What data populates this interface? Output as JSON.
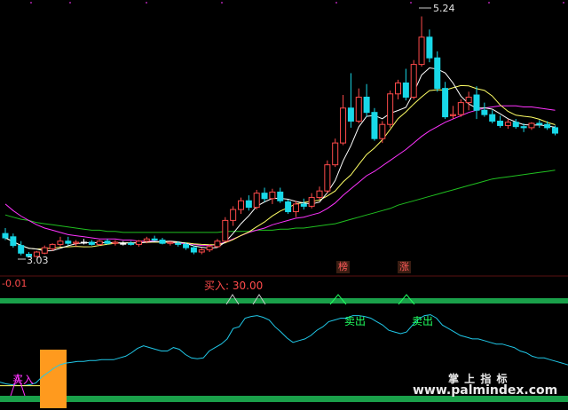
{
  "chart_data": [
    {
      "type": "candlestick",
      "price_labels": {
        "high": "5.24",
        "low": "3.03"
      },
      "markers": [
        "榜",
        "涨"
      ],
      "colors": {
        "up": "#ff4b4b",
        "down": "#18d8e8",
        "flat": "#ffffff",
        "ma_short": "#ffffff",
        "ma_mid": "#ffff66",
        "ma_long": "#ff33ff",
        "ma_longest": "#20c020"
      },
      "candles": [
        {
          "o": 3.25,
          "h": 3.3,
          "l": 3.19,
          "c": 3.21
        },
        {
          "o": 3.22,
          "h": 3.25,
          "l": 3.12,
          "c": 3.14
        },
        {
          "o": 3.14,
          "h": 3.18,
          "l": 3.05,
          "c": 3.07
        },
        {
          "o": 3.06,
          "h": 3.08,
          "l": 3.03,
          "c": 3.04
        },
        {
          "o": 3.04,
          "h": 3.09,
          "l": 3.03,
          "c": 3.08
        },
        {
          "o": 3.07,
          "h": 3.14,
          "l": 3.06,
          "c": 3.12
        },
        {
          "o": 3.11,
          "h": 3.16,
          "l": 3.09,
          "c": 3.15
        },
        {
          "o": 3.15,
          "h": 3.22,
          "l": 3.13,
          "c": 3.18
        },
        {
          "o": 3.18,
          "h": 3.22,
          "l": 3.14,
          "c": 3.16
        },
        {
          "o": 3.16,
          "h": 3.19,
          "l": 3.13,
          "c": 3.17
        },
        {
          "o": 3.17,
          "h": 3.2,
          "l": 3.15,
          "c": 3.17
        },
        {
          "o": 3.17,
          "h": 3.19,
          "l": 3.14,
          "c": 3.15
        },
        {
          "o": 3.15,
          "h": 3.19,
          "l": 3.14,
          "c": 3.18
        },
        {
          "o": 3.18,
          "h": 3.2,
          "l": 3.15,
          "c": 3.16
        },
        {
          "o": 3.16,
          "h": 3.19,
          "l": 3.14,
          "c": 3.17
        },
        {
          "o": 3.16,
          "h": 3.18,
          "l": 3.14,
          "c": 3.16
        },
        {
          "o": 3.16,
          "h": 3.18,
          "l": 3.14,
          "c": 3.15
        },
        {
          "o": 3.15,
          "h": 3.19,
          "l": 3.13,
          "c": 3.18
        },
        {
          "o": 3.18,
          "h": 3.22,
          "l": 3.16,
          "c": 3.2
        },
        {
          "o": 3.2,
          "h": 3.23,
          "l": 3.18,
          "c": 3.19
        },
        {
          "o": 3.19,
          "h": 3.21,
          "l": 3.15,
          "c": 3.16
        },
        {
          "o": 3.16,
          "h": 3.18,
          "l": 3.14,
          "c": 3.17
        },
        {
          "o": 3.16,
          "h": 3.18,
          "l": 3.13,
          "c": 3.15
        },
        {
          "o": 3.15,
          "h": 3.17,
          "l": 3.1,
          "c": 3.12
        },
        {
          "o": 3.12,
          "h": 3.14,
          "l": 3.06,
          "c": 3.08
        },
        {
          "o": 3.08,
          "h": 3.12,
          "l": 3.06,
          "c": 3.1
        },
        {
          "o": 3.1,
          "h": 3.15,
          "l": 3.08,
          "c": 3.13
        },
        {
          "o": 3.13,
          "h": 3.2,
          "l": 3.12,
          "c": 3.18
        },
        {
          "o": 3.18,
          "h": 3.4,
          "l": 3.17,
          "c": 3.37
        },
        {
          "o": 3.37,
          "h": 3.5,
          "l": 3.32,
          "c": 3.47
        },
        {
          "o": 3.47,
          "h": 3.58,
          "l": 3.43,
          "c": 3.55
        },
        {
          "o": 3.55,
          "h": 3.6,
          "l": 3.46,
          "c": 3.49
        },
        {
          "o": 3.49,
          "h": 3.65,
          "l": 3.47,
          "c": 3.62
        },
        {
          "o": 3.62,
          "h": 3.67,
          "l": 3.54,
          "c": 3.57
        },
        {
          "o": 3.57,
          "h": 3.66,
          "l": 3.52,
          "c": 3.63
        },
        {
          "o": 3.63,
          "h": 3.67,
          "l": 3.53,
          "c": 3.55
        },
        {
          "o": 3.54,
          "h": 3.56,
          "l": 3.43,
          "c": 3.45
        },
        {
          "o": 3.45,
          "h": 3.55,
          "l": 3.4,
          "c": 3.52
        },
        {
          "o": 3.52,
          "h": 3.57,
          "l": 3.47,
          "c": 3.5
        },
        {
          "o": 3.5,
          "h": 3.62,
          "l": 3.48,
          "c": 3.58
        },
        {
          "o": 3.58,
          "h": 3.68,
          "l": 3.56,
          "c": 3.64
        },
        {
          "o": 3.64,
          "h": 3.92,
          "l": 3.62,
          "c": 3.88
        },
        {
          "o": 3.88,
          "h": 4.12,
          "l": 3.86,
          "c": 4.08
        },
        {
          "o": 4.08,
          "h": 4.52,
          "l": 4.06,
          "c": 4.4
        },
        {
          "o": 4.4,
          "h": 4.72,
          "l": 4.22,
          "c": 4.28
        },
        {
          "o": 4.28,
          "h": 4.58,
          "l": 4.26,
          "c": 4.5
        },
        {
          "o": 4.5,
          "h": 4.62,
          "l": 4.32,
          "c": 4.36
        },
        {
          "o": 4.36,
          "h": 4.4,
          "l": 4.1,
          "c": 4.12
        },
        {
          "o": 4.12,
          "h": 4.28,
          "l": 4.08,
          "c": 4.25
        },
        {
          "o": 4.25,
          "h": 4.56,
          "l": 4.22,
          "c": 4.53
        },
        {
          "o": 4.53,
          "h": 4.66,
          "l": 4.48,
          "c": 4.63
        },
        {
          "o": 4.63,
          "h": 4.76,
          "l": 4.47,
          "c": 4.5
        },
        {
          "o": 4.5,
          "h": 4.84,
          "l": 4.48,
          "c": 4.8
        },
        {
          "o": 4.8,
          "h": 5.24,
          "l": 4.78,
          "c": 5.05
        },
        {
          "o": 5.05,
          "h": 5.12,
          "l": 4.82,
          "c": 4.86
        },
        {
          "o": 4.86,
          "h": 4.92,
          "l": 4.55,
          "c": 4.58
        },
        {
          "o": 4.58,
          "h": 4.64,
          "l": 4.3,
          "c": 4.32
        },
        {
          "o": 4.33,
          "h": 4.42,
          "l": 4.3,
          "c": 4.34
        },
        {
          "o": 4.34,
          "h": 4.48,
          "l": 4.32,
          "c": 4.45
        },
        {
          "o": 4.45,
          "h": 4.55,
          "l": 4.38,
          "c": 4.5
        },
        {
          "o": 4.52,
          "h": 4.6,
          "l": 4.3,
          "c": 4.38
        },
        {
          "o": 4.38,
          "h": 4.45,
          "l": 4.32,
          "c": 4.34
        },
        {
          "o": 4.34,
          "h": 4.38,
          "l": 4.26,
          "c": 4.28
        },
        {
          "o": 4.28,
          "h": 4.33,
          "l": 4.22,
          "c": 4.24
        },
        {
          "o": 4.24,
          "h": 4.3,
          "l": 4.21,
          "c": 4.27
        },
        {
          "o": 4.27,
          "h": 4.3,
          "l": 4.21,
          "c": 4.23
        },
        {
          "o": 4.23,
          "h": 4.26,
          "l": 4.18,
          "c": 4.22
        },
        {
          "o": 4.22,
          "h": 4.27,
          "l": 4.2,
          "c": 4.26
        },
        {
          "o": 4.26,
          "h": 4.29,
          "l": 4.22,
          "c": 4.25
        },
        {
          "o": 4.25,
          "h": 4.28,
          "l": 4.2,
          "c": 4.22
        },
        {
          "o": 4.22,
          "h": 4.24,
          "l": 4.15,
          "c": 4.17
        }
      ],
      "ma_long": [
        3.52,
        3.46,
        3.41,
        3.37,
        3.33,
        3.3,
        3.28,
        3.26,
        3.24,
        3.23,
        3.22,
        3.21,
        3.2,
        3.2,
        3.2,
        3.19,
        3.19,
        3.18,
        3.18,
        3.18,
        3.17,
        3.17,
        3.16,
        3.16,
        3.15,
        3.14,
        3.14,
        3.15,
        3.17,
        3.2,
        3.23,
        3.26,
        3.28,
        3.3,
        3.33,
        3.35,
        3.37,
        3.39,
        3.4,
        3.42,
        3.44,
        3.48,
        3.53,
        3.6,
        3.66,
        3.72,
        3.78,
        3.82,
        3.87,
        3.92,
        3.97,
        4.02,
        4.08,
        4.14,
        4.19,
        4.23,
        4.27,
        4.3,
        4.33,
        4.36,
        4.38,
        4.4,
        4.41,
        4.42,
        4.42,
        4.42,
        4.41,
        4.41,
        4.4,
        4.39,
        4.38
      ],
      "ma_longest": [
        3.42,
        3.4,
        3.38,
        3.37,
        3.35,
        3.34,
        3.33,
        3.32,
        3.31,
        3.3,
        3.29,
        3.28,
        3.28,
        3.27,
        3.27,
        3.26,
        3.26,
        3.26,
        3.26,
        3.26,
        3.26,
        3.26,
        3.26,
        3.26,
        3.26,
        3.26,
        3.26,
        3.26,
        3.27,
        3.27,
        3.27,
        3.27,
        3.28,
        3.28,
        3.28,
        3.29,
        3.29,
        3.3,
        3.3,
        3.31,
        3.32,
        3.33,
        3.34,
        3.36,
        3.38,
        3.4,
        3.42,
        3.44,
        3.46,
        3.48,
        3.51,
        3.53,
        3.55,
        3.57,
        3.59,
        3.61,
        3.63,
        3.65,
        3.67,
        3.69,
        3.71,
        3.73,
        3.75,
        3.76,
        3.77,
        3.78,
        3.79,
        3.8,
        3.81,
        3.82,
        3.83
      ],
      "ylim": [
        2.95,
        5.35
      ]
    },
    {
      "type": "line",
      "readout": "-0.01",
      "title": "买入: 30.00",
      "signals": {
        "buy": "买入",
        "sell": "卖出"
      },
      "values": [
        22,
        20,
        19,
        18,
        18,
        19,
        21,
        28,
        33,
        38,
        42,
        44,
        45,
        46,
        46,
        47,
        47,
        48,
        48,
        48,
        50,
        52,
        56,
        61,
        64,
        62,
        60,
        58,
        58,
        62,
        60,
        54,
        50,
        49,
        50,
        58,
        62,
        66,
        72,
        84,
        86,
        96,
        98,
        99,
        97,
        94,
        86,
        80,
        73,
        68,
        70,
        72,
        76,
        82,
        86,
        92,
        94,
        96,
        96,
        99,
        99,
        98,
        96,
        92,
        88,
        82,
        80,
        78,
        80,
        88,
        95,
        99,
        100,
        96,
        88,
        84,
        80,
        76,
        74,
        72,
        72,
        70,
        68,
        66,
        66,
        64,
        62,
        58,
        56,
        52,
        50,
        50,
        48,
        46,
        44,
        42
      ],
      "ylim": [
        0,
        115
      ]
    }
  ],
  "watermark": {
    "line1": "掌 上 指 标",
    "line2": "www.palmindex.com"
  }
}
